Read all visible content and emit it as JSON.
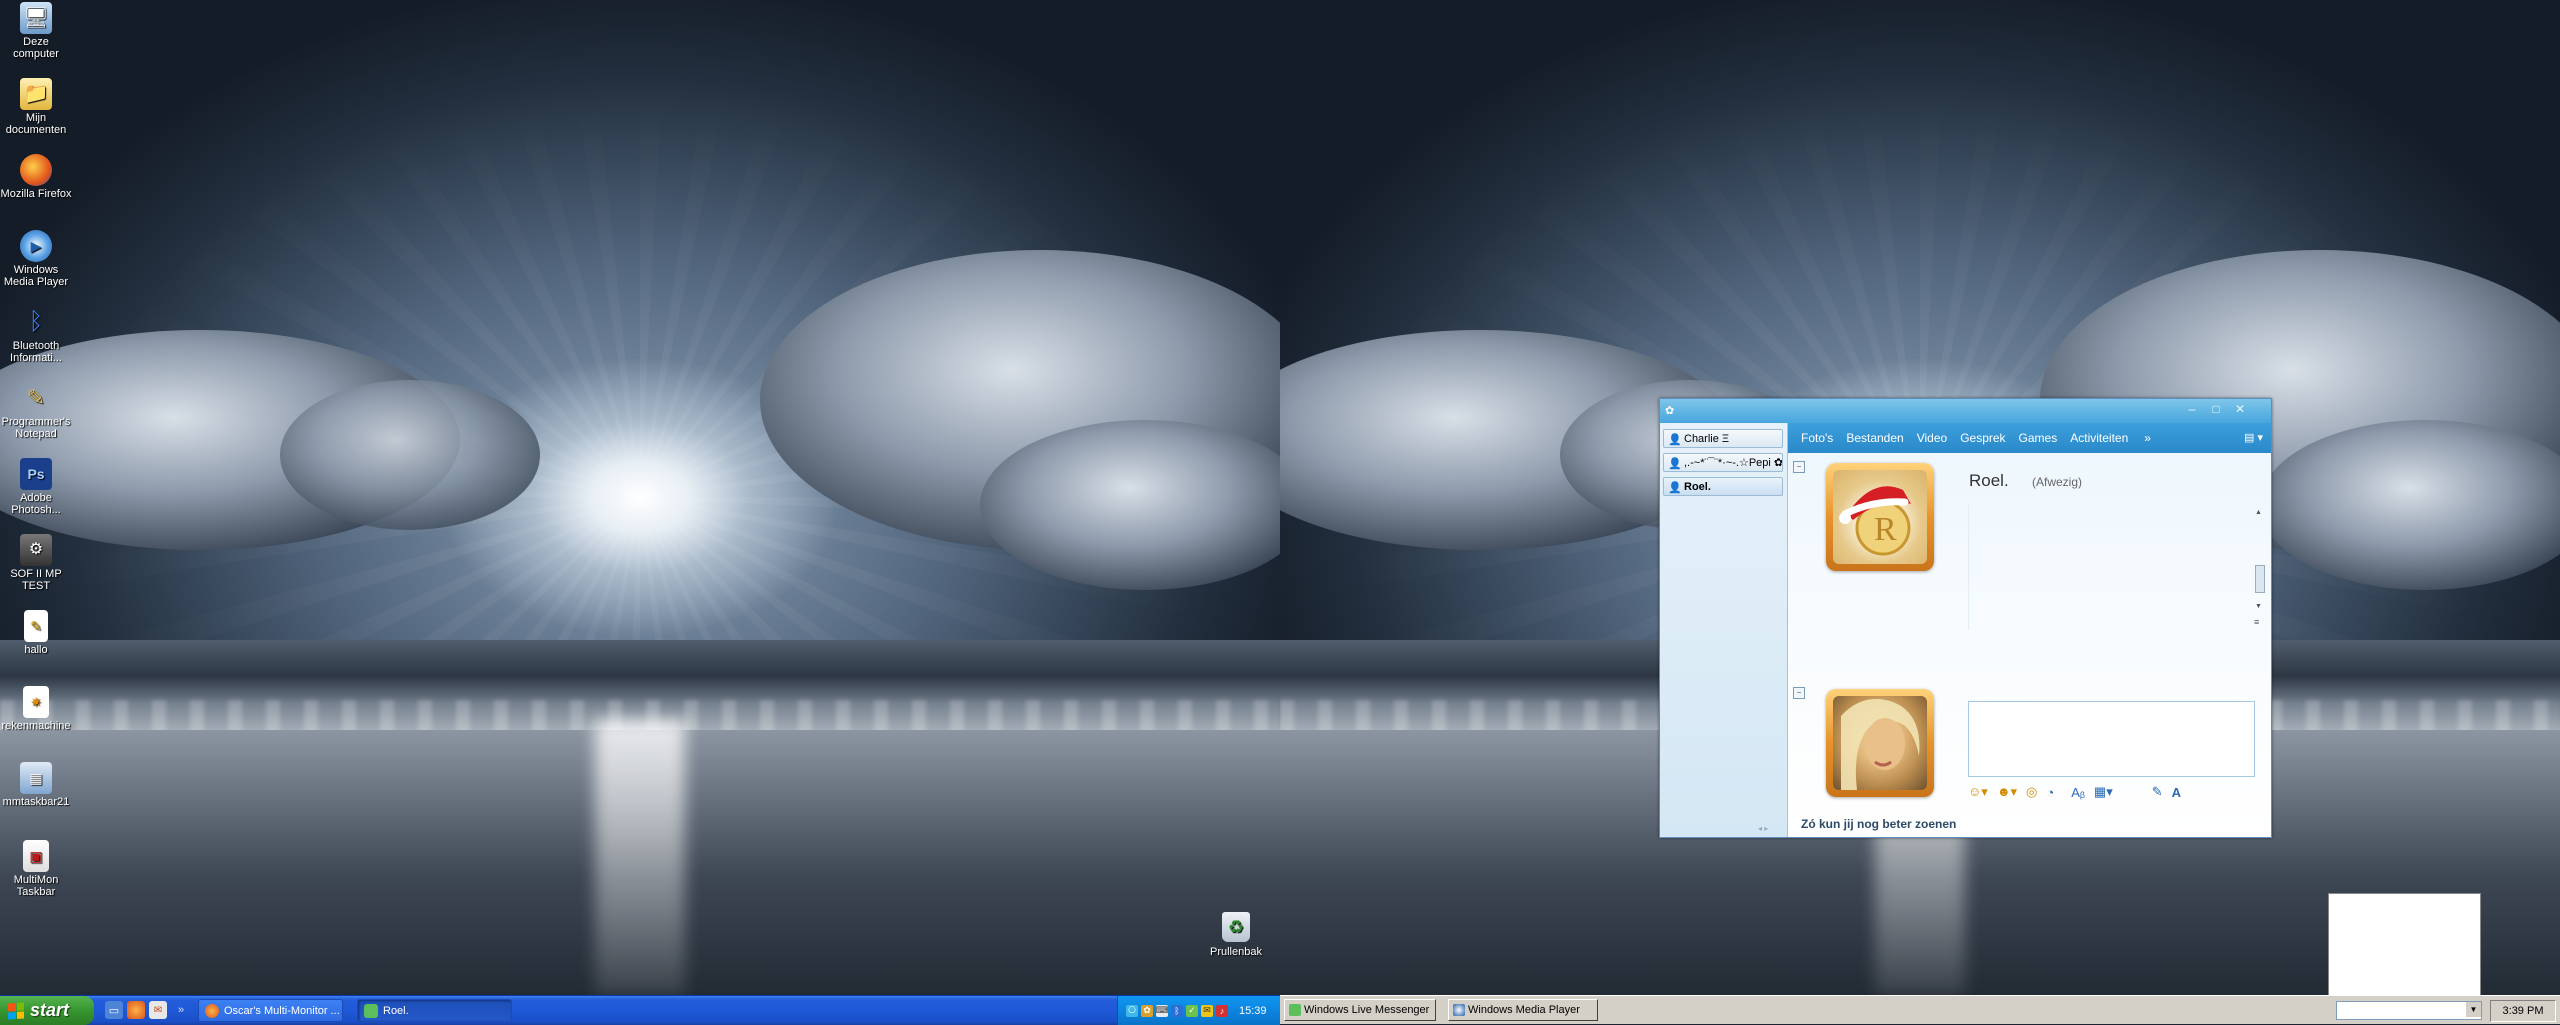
{
  "desktop_icons": [
    {
      "label": "Deze computer",
      "icon": "my-computer-icon"
    },
    {
      "label": "Mijn documenten",
      "icon": "my-documents-icon"
    },
    {
      "label": "Mozilla Firefox",
      "icon": "firefox-icon"
    },
    {
      "label": "Windows Media Player",
      "icon": "media-player-icon"
    },
    {
      "label": "Bluetooth Informati...",
      "icon": "bluetooth-icon"
    },
    {
      "label": "Programmer's Notepad",
      "icon": "notepad-icon"
    },
    {
      "label": "Adobe Photosh...",
      "icon": "photoshop-icon"
    },
    {
      "label": "SOF II MP TEST",
      "icon": "game-icon"
    },
    {
      "label": "hallo",
      "icon": "text-file-icon"
    },
    {
      "label": "rekenmachine",
      "icon": "calculator-icon"
    },
    {
      "label": "mmtaskbar21",
      "icon": "application-icon"
    },
    {
      "label": "MultiMon Taskbar",
      "icon": "multimon-icon"
    }
  ],
  "recycle_bin": {
    "label": "Prullenbak"
  },
  "taskbar_left": {
    "start_label": "start",
    "tasks": [
      {
        "label": "Oscar's Multi-Monitor ...",
        "active": false
      },
      {
        "label": "Roel.",
        "active": true
      }
    ],
    "clock": "15:39"
  },
  "taskbar_right": {
    "tasks": [
      {
        "label": "Windows Live Messenger"
      },
      {
        "label": "Windows Media Player"
      }
    ],
    "clock": "3:39 PM"
  },
  "messenger": {
    "conversations": [
      {
        "label": "Charlie Ξ",
        "active": false
      },
      {
        "label": ",.-~*¨¯¨*·~-.☆Pepi ✿...",
        "active": false
      },
      {
        "label": "Roel.",
        "active": true
      }
    ],
    "menu": [
      "Foto's",
      "Bestanden",
      "Video",
      "Gesprek",
      "Games",
      "Activiteiten"
    ],
    "more_label": "»",
    "contact_name": "Roel.",
    "contact_status": "(Afwezig)",
    "status_message": "Zó kun jij nog beter zoenen"
  },
  "colors": {
    "xp_taskbar": "#245edb",
    "start_green": "#36962f",
    "msn_blue": "#2a89c9",
    "avatar_orange": "#e7942a"
  }
}
